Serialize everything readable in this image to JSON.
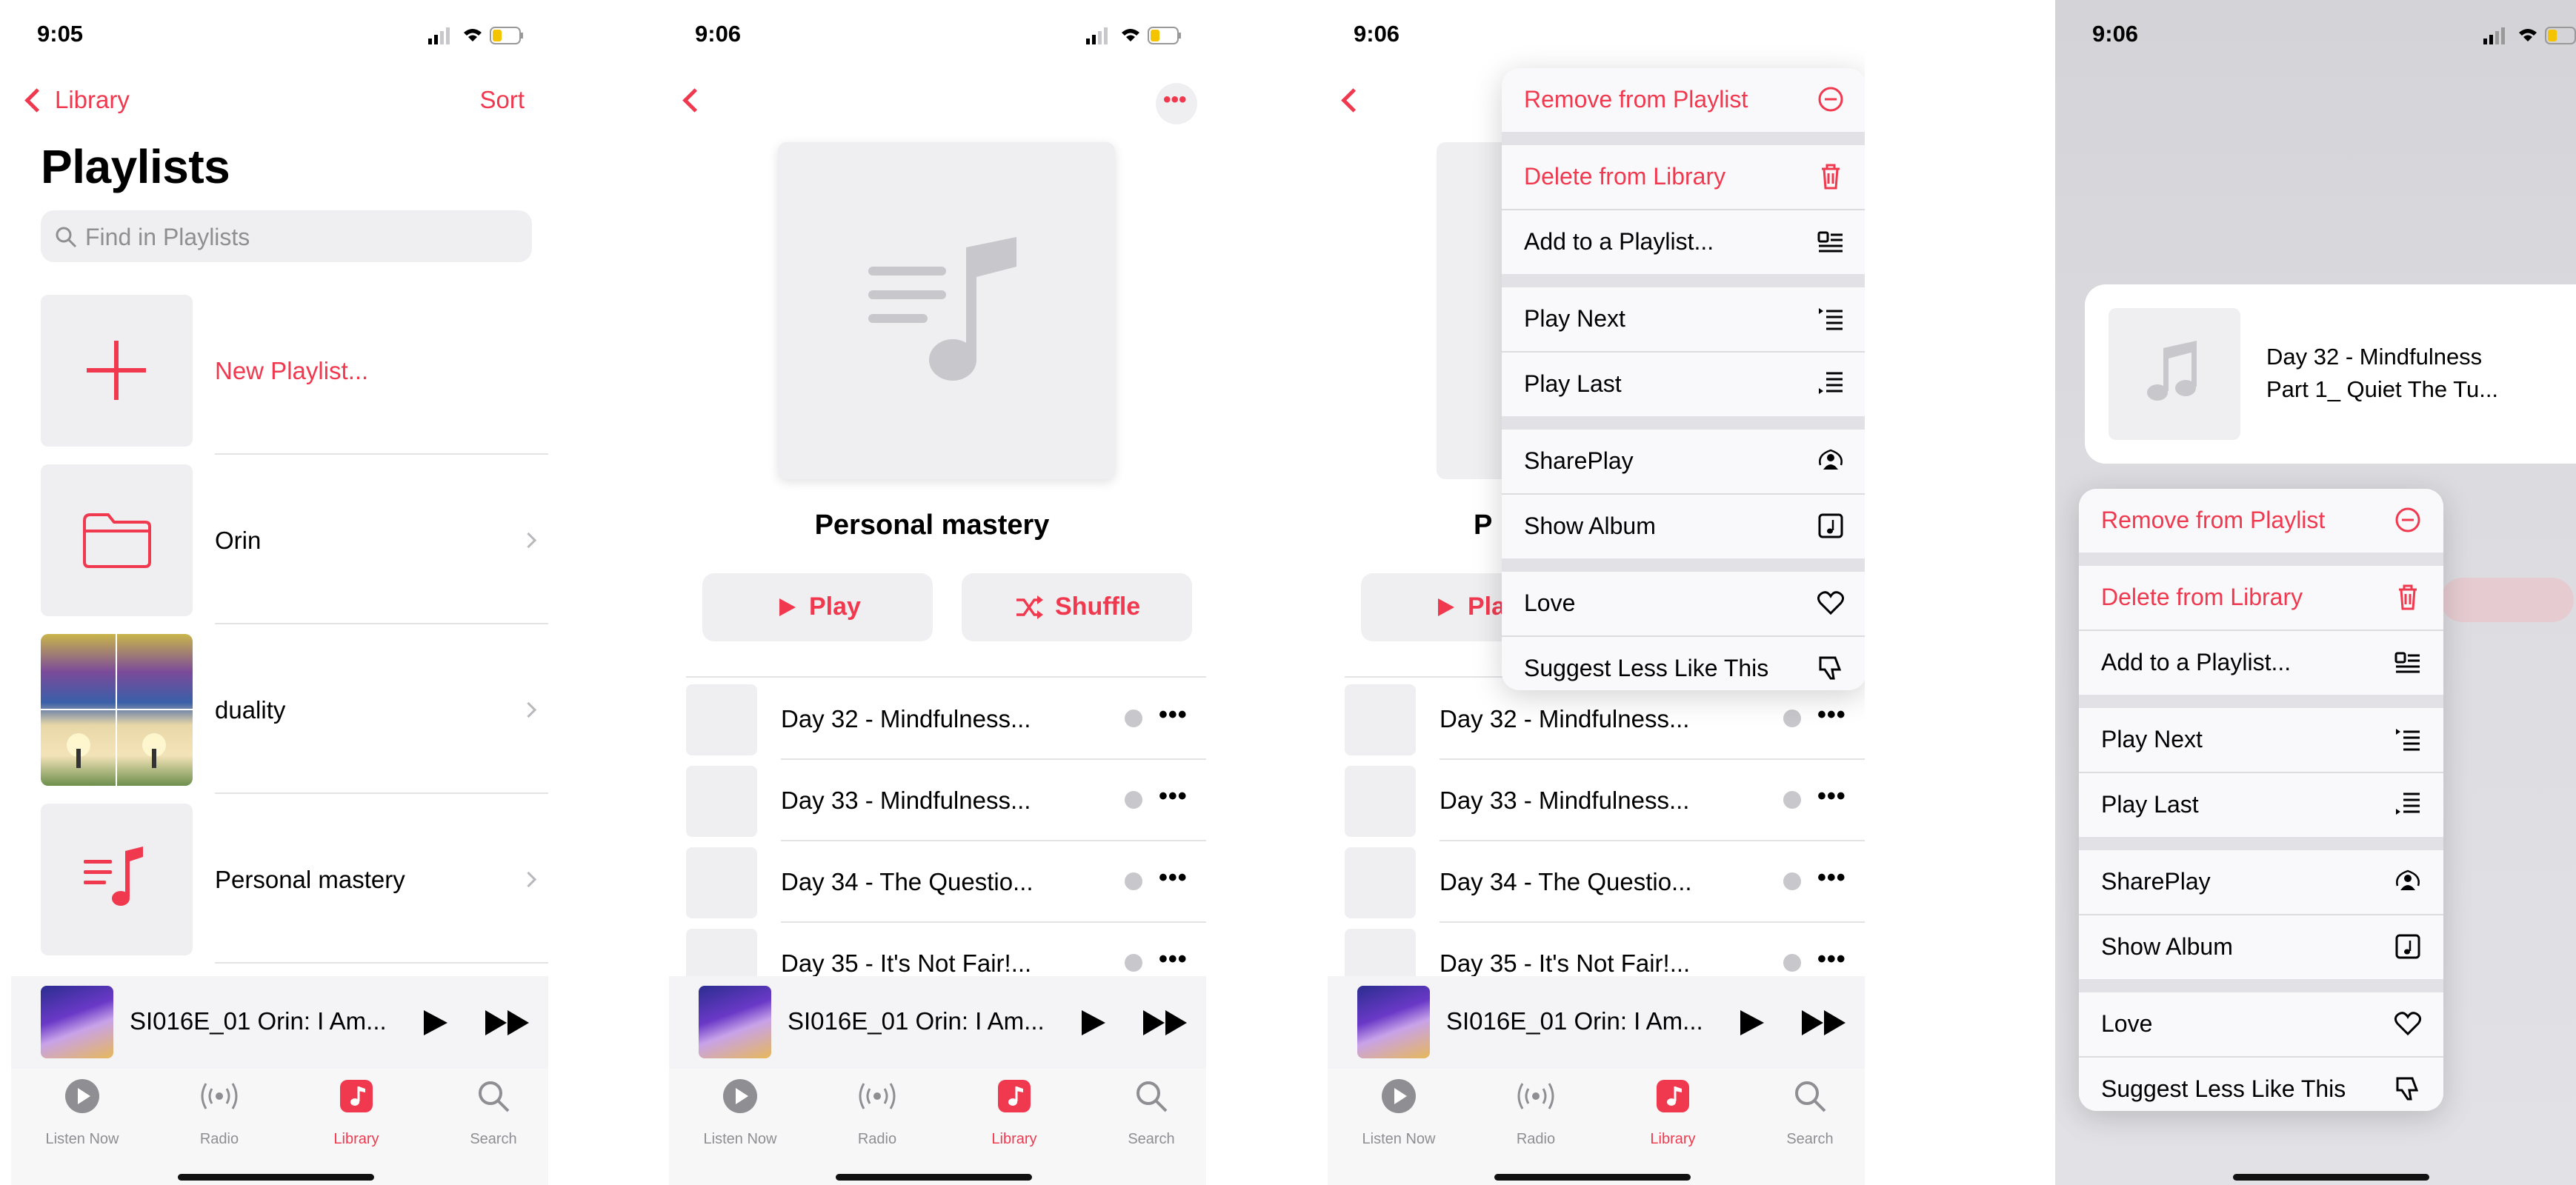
{
  "screens": [
    {
      "time": "9:05",
      "nav": {
        "back": "Library",
        "sort": "Sort"
      },
      "title": "Playlists",
      "search_placeholder": "Find in Playlists",
      "rows": [
        {
          "label": "New Playlist..."
        },
        {
          "label": "Orin"
        },
        {
          "label": "duality"
        },
        {
          "label": "Personal mastery"
        }
      ],
      "mini_player": {
        "title": "SI016E_01 Orin: I Am..."
      },
      "tabs": [
        "Listen Now",
        "Radio",
        "Library",
        "Search"
      ]
    },
    {
      "time": "9:06",
      "playlist_title": "Personal mastery",
      "play": "Play",
      "shuffle": "Shuffle",
      "songs": [
        "Day 32 - Mindfulness...",
        "Day 33 - Mindfulness...",
        "Day 34 - The Questio...",
        "Day 35 - It's Not Fair!..."
      ],
      "mini_player": {
        "title": "SI016E_01 Orin: I Am..."
      },
      "tabs": [
        "Listen Now",
        "Radio",
        "Library",
        "Search"
      ]
    },
    {
      "time": "9:06",
      "partial_title": "P",
      "partial_play": "Pla",
      "songs": [
        "Day 32 - Mindfulness...",
        "Day 33 - Mindfulness...",
        "Day 34 - The Questio...",
        "Day 35 - It's Not Fair!..."
      ],
      "menu": [
        "Remove from Playlist",
        "Delete from Library",
        "Add to a Playlist...",
        "Play Next",
        "Play Last",
        "SharePlay",
        "Show Album",
        "Love",
        "Suggest Less Like This"
      ],
      "mini_player": {
        "title": "SI016E_01 Orin: I Am..."
      },
      "tabs": [
        "Listen Now",
        "Radio",
        "Library",
        "Search"
      ]
    },
    {
      "time": "9:06",
      "preview": {
        "line1": "Day 32 - Mindfulness",
        "line2": "Part 1_ Quiet The Tu..."
      },
      "menu": [
        "Remove from Playlist",
        "Delete from Library",
        "Add to a Playlist...",
        "Play Next",
        "Play Last",
        "SharePlay",
        "Show Album",
        "Love",
        "Suggest Less Like This"
      ]
    }
  ],
  "colors": {
    "accent": "#f0394f",
    "background": "#ffffff",
    "fill": "#efeff1"
  },
  "icons": [
    "back-chevron-icon",
    "search-icon",
    "plus-icon",
    "folder-icon",
    "music-note-icon",
    "chevron-right-icon",
    "play-icon",
    "shuffle-icon",
    "ellipsis-icon",
    "download-icon",
    "fast-forward-icon",
    "listen-now-icon",
    "radio-icon",
    "library-icon",
    "minus-circle-icon",
    "trash-icon",
    "add-to-playlist-icon",
    "play-next-icon",
    "play-last-icon",
    "shareplay-icon",
    "show-album-icon",
    "heart-icon",
    "thumbs-down-icon"
  ]
}
